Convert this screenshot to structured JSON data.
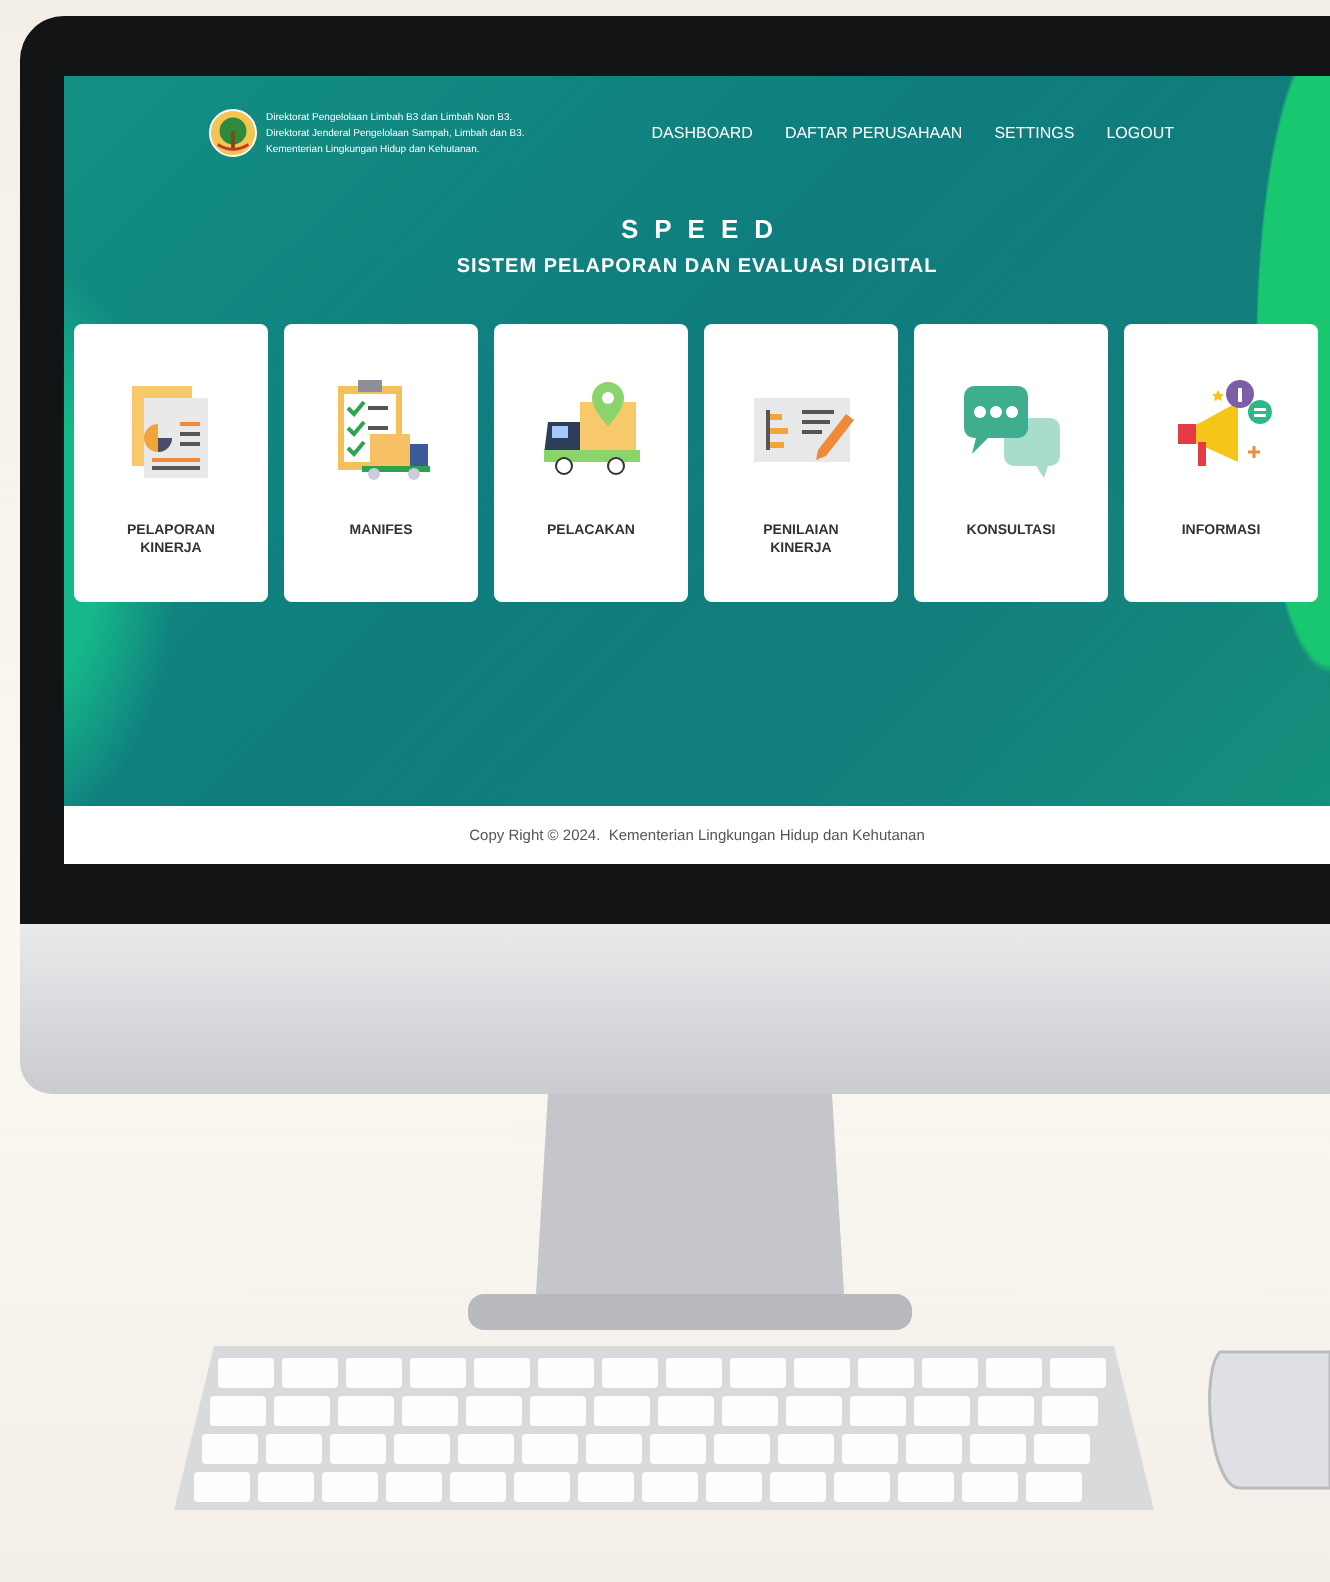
{
  "header": {
    "org_lines": [
      "Direktorat Pengelolaan Limbah B3 dan Limbah Non B3.",
      "Direktorat Jenderal Pengelolaan Sampah, Limbah dan B3.",
      "Kementerian Lingkungan Hidup dan Kehutanan."
    ]
  },
  "nav": [
    {
      "label": "DASHBOARD"
    },
    {
      "label": "DAFTAR PERUSAHAAN"
    },
    {
      "label": "SETTINGS"
    },
    {
      "label": "LOGOUT"
    }
  ],
  "hero": {
    "title": "SPEED",
    "subtitle": "SISTEM PELAPORAN DAN EVALUASI DIGITAL"
  },
  "menu_cards": [
    {
      "label": "PELAPORAN KINERJA"
    },
    {
      "label": "MANIFES"
    },
    {
      "label": "PELACAKAN"
    },
    {
      "label": "PENILAIAN KINERJA"
    },
    {
      "label": "KONSULTASI"
    },
    {
      "label": "INFORMASI"
    }
  ],
  "footer": {
    "text": "Copy Right © 2024.  Kementerian Lingkungan Hidup dan Kehutanan"
  }
}
